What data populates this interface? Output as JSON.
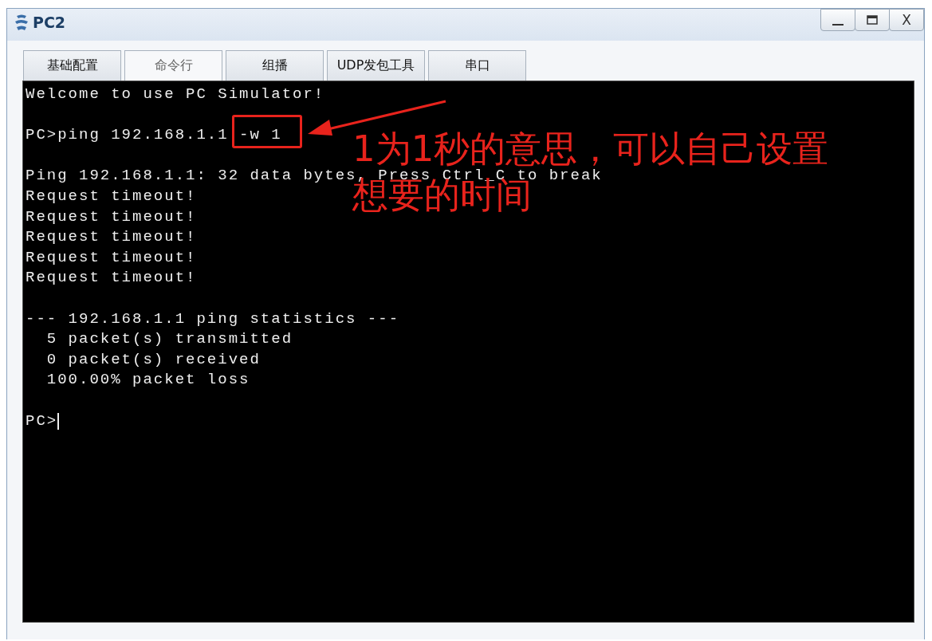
{
  "window": {
    "title": "PC2",
    "close_label": "X"
  },
  "tabs": [
    {
      "label": "基础配置",
      "selected": false
    },
    {
      "label": "命令行",
      "selected": true
    },
    {
      "label": "组播",
      "selected": false
    },
    {
      "label": "UDP发包工具",
      "selected": false
    },
    {
      "label": "串口",
      "selected": false
    }
  ],
  "terminal": {
    "lines": [
      {
        "kind": "text",
        "text": "Welcome to use PC Simulator!"
      },
      {
        "kind": "blank"
      },
      {
        "kind": "text",
        "text": "PC>ping 192.168.1.1 -w 1"
      },
      {
        "kind": "blank"
      },
      {
        "kind": "text",
        "text": "Ping 192.168.1.1: 32 data bytes, Press Ctrl_C to break"
      },
      {
        "kind": "text",
        "text": "Request timeout!"
      },
      {
        "kind": "text",
        "text": "Request timeout!"
      },
      {
        "kind": "text",
        "text": "Request timeout!"
      },
      {
        "kind": "text",
        "text": "Request timeout!"
      },
      {
        "kind": "text",
        "text": "Request timeout!"
      },
      {
        "kind": "blank"
      },
      {
        "kind": "text",
        "text": "--- 192.168.1.1 ping statistics ---"
      },
      {
        "kind": "text",
        "text": "  5 packet(s) transmitted"
      },
      {
        "kind": "text",
        "text": "  0 packet(s) received"
      },
      {
        "kind": "text",
        "text": "  100.00% packet loss"
      },
      {
        "kind": "blank"
      },
      {
        "kind": "text",
        "text": "PC>"
      }
    ],
    "cursor": true
  },
  "annotation": {
    "lines": [
      "1为1秒的意思，可以自己设置",
      "想要的时间"
    ]
  }
}
